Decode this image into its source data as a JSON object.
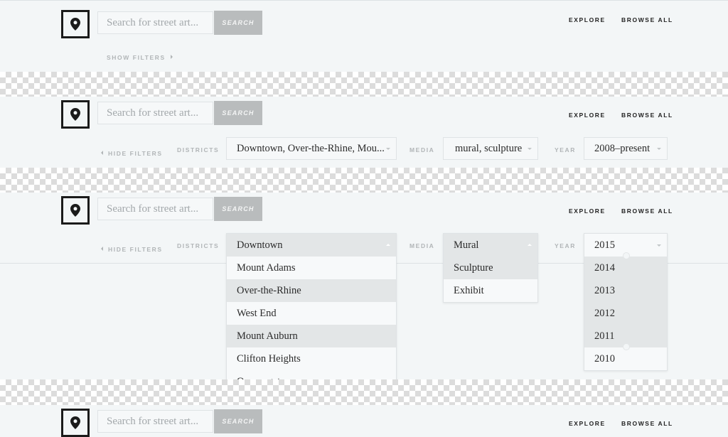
{
  "header": {
    "search_placeholder": "Search for street art...",
    "search_button": "SEARCH",
    "nav_explore": "EXPLORE",
    "nav_browse_all": "BROWSE ALL"
  },
  "filters": {
    "show_filters": "SHOW FILTERS",
    "hide_filters": "HIDE FILTERS",
    "districts_label": "DISTRICTS",
    "media_label": "MEDIA",
    "year_label": "YEAR",
    "districts_value": "Downtown, Over-the-Rhine, Mou...",
    "media_value": "mural, sculpture",
    "year_value": "2008–present"
  },
  "dropdowns": {
    "districts": [
      "Downtown",
      "Mount Adams",
      "Over-the-Rhine",
      "West End",
      "Mount Auburn",
      "Clifton Heights",
      "Queensgate"
    ],
    "media": [
      "Mural",
      "Sculpture",
      "Exhibit"
    ],
    "years": [
      "2015",
      "2014",
      "2013",
      "2012",
      "2011",
      "2010"
    ]
  },
  "icons": {
    "logo": "map-pin-icon",
    "caret_down": "caret-down-icon",
    "caret_up": "caret-up-icon",
    "arrow_right": "chevron-right-icon",
    "arrow_left": "chevron-left-icon"
  },
  "colors": {
    "background": "#f3f6f7",
    "search_button": "#b9bcbd",
    "selected_row": "#e3e6e7",
    "logo_border": "#1b1b1b"
  }
}
